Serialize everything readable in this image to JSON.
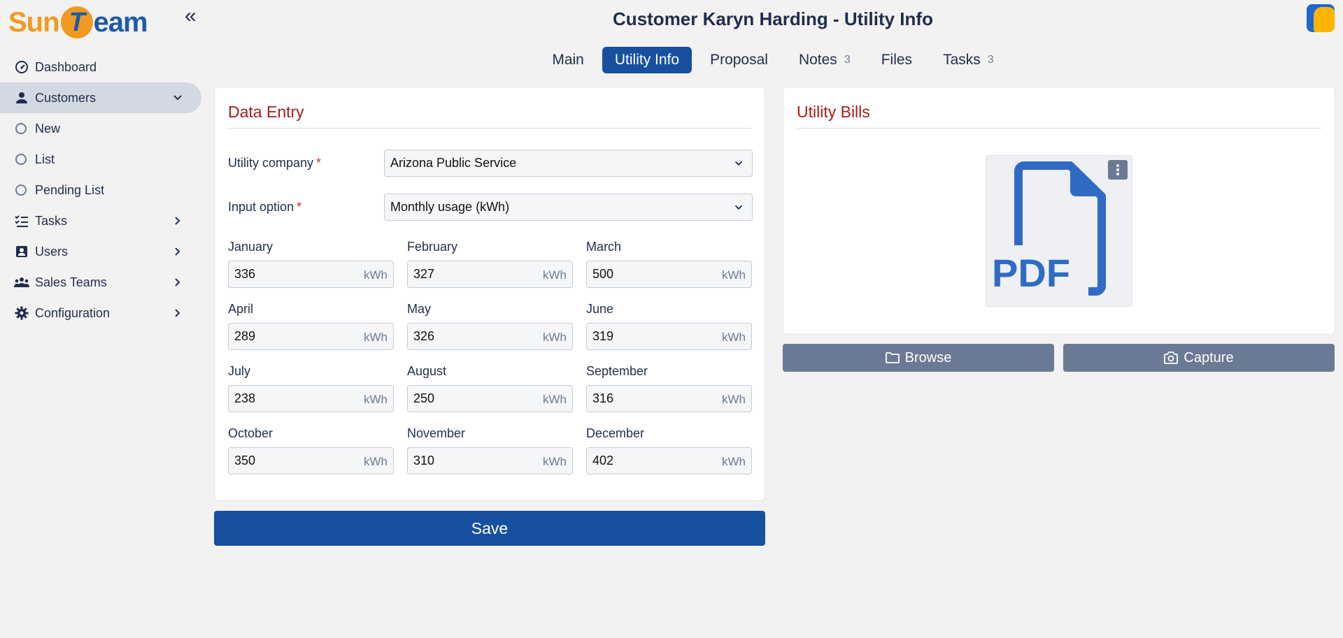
{
  "brand": {
    "sun": "Sun",
    "t": "T",
    "eam": "eam"
  },
  "header": {
    "title": "Customer Karyn Harding - Utility Info"
  },
  "sidebar": {
    "collapse_glyph": "«",
    "items": [
      {
        "label": "Dashboard",
        "icon": "dashboard-icon"
      },
      {
        "label": "Customers",
        "icon": "user-icon"
      },
      {
        "label": "Tasks",
        "icon": "tasks-icon"
      },
      {
        "label": "Users",
        "icon": "users-icon"
      },
      {
        "label": "Sales Teams",
        "icon": "team-icon"
      },
      {
        "label": "Configuration",
        "icon": "gear-icon"
      }
    ],
    "customer_sub": [
      {
        "label": "New"
      },
      {
        "label": "List"
      },
      {
        "label": "Pending List"
      }
    ]
  },
  "tabs": [
    {
      "label": "Main",
      "badge": ""
    },
    {
      "label": "Utility Info",
      "badge": ""
    },
    {
      "label": "Proposal",
      "badge": ""
    },
    {
      "label": "Notes",
      "badge": "3"
    },
    {
      "label": "Files",
      "badge": ""
    },
    {
      "label": "Tasks",
      "badge": "3"
    }
  ],
  "data_entry": {
    "title": "Data Entry",
    "utility_company_label": "Utility company",
    "utility_company_value": "Arizona Public Service",
    "input_option_label": "Input option",
    "input_option_value": "Monthly usage (kWh)",
    "required_mark": "*",
    "unit": "kWh",
    "months": [
      {
        "label": "January",
        "value": "336"
      },
      {
        "label": "February",
        "value": "327"
      },
      {
        "label": "March",
        "value": "500"
      },
      {
        "label": "April",
        "value": "289"
      },
      {
        "label": "May",
        "value": "326"
      },
      {
        "label": "June",
        "value": "319"
      },
      {
        "label": "July",
        "value": "238"
      },
      {
        "label": "August",
        "value": "250"
      },
      {
        "label": "September",
        "value": "316"
      },
      {
        "label": "October",
        "value": "350"
      },
      {
        "label": "November",
        "value": "310"
      },
      {
        "label": "December",
        "value": "402"
      }
    ]
  },
  "save_label": "Save",
  "utility_bills": {
    "title": "Utility Bills",
    "pdf_text": "PDF",
    "browse_label": "Browse",
    "capture_label": "Capture"
  },
  "colors": {
    "primary": "#17509f",
    "accent_orange": "#f29a1f",
    "title_red": "#a51d1d",
    "secondary_button": "#6b7a94",
    "pdf_blue": "#2f6bc4"
  }
}
